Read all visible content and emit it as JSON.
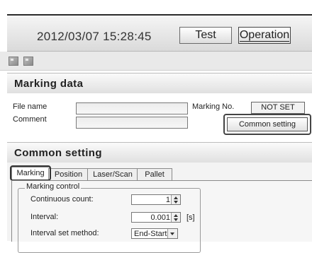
{
  "header": {
    "datetime": "2012/03/07 15:28:45",
    "test_label": "Test",
    "operation_label": "Operation"
  },
  "marking_section": {
    "title": "Marking data",
    "file_name_label": "File name",
    "comment_label": "Comment",
    "marking_no_label": "Marking No.",
    "marking_no_value": "NOT SET",
    "file_name_value": "",
    "comment_value": "",
    "common_setting_button": "Common setting"
  },
  "common_section": {
    "title": "Common setting",
    "tabs": [
      {
        "label": "Marking"
      },
      {
        "label": "Position"
      },
      {
        "label": "Laser/Scan"
      },
      {
        "label": "Pallet"
      }
    ],
    "group_title": "Marking control",
    "continuous_count_label": "Continuous count:",
    "continuous_count_value": "1",
    "interval_label": "Interval:",
    "interval_value": "0.001",
    "interval_unit": "[s]",
    "interval_method_label": "Interval set method:",
    "interval_method_value": "End-Start"
  }
}
